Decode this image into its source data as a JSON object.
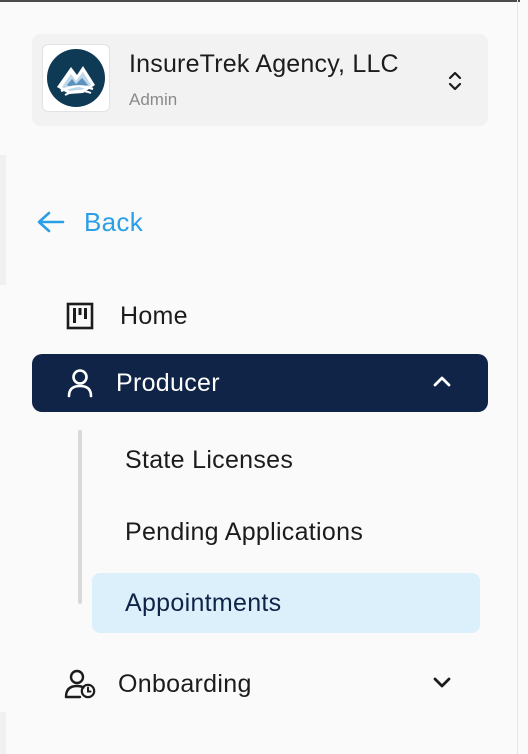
{
  "org": {
    "name": "InsureTrek Agency, LLC",
    "role": "Admin",
    "logo_icon": "mountain-logo-icon",
    "switcher_icon": "chevron-up-down-icon"
  },
  "back": {
    "label": "Back",
    "icon": "arrow-left-icon",
    "color": "#2b9fe6"
  },
  "nav": {
    "home": {
      "label": "Home",
      "icon": "kanban-board-icon"
    },
    "producer": {
      "label": "Producer",
      "icon": "user-icon",
      "expanded": true,
      "active": true,
      "active_bg": "#0f2447",
      "children": [
        {
          "label": "State Licenses"
        },
        {
          "label": "Pending Applications"
        },
        {
          "label": "Appointments",
          "selected": true,
          "selected_bg": "#dcf0fc"
        }
      ]
    },
    "onboarding": {
      "label": "Onboarding",
      "icon": "user-clock-icon",
      "expanded": false
    }
  }
}
